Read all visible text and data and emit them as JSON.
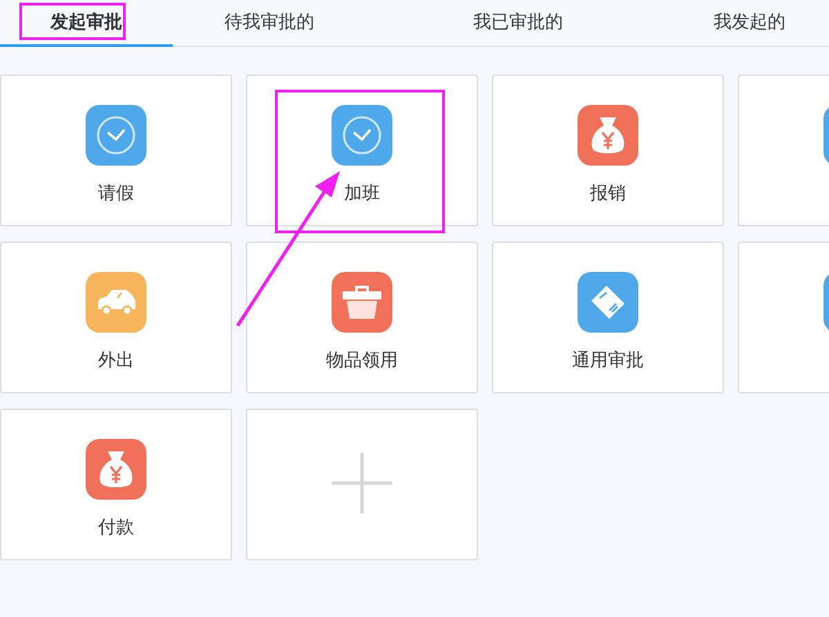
{
  "tabs": [
    {
      "label": "发起审批",
      "selected": true,
      "highlighted": true
    },
    {
      "label": "待我审批的",
      "selected": false,
      "highlighted": false
    },
    {
      "label": "我已审批的",
      "selected": false,
      "highlighted": false
    },
    {
      "label": "我发起的",
      "selected": false,
      "highlighted": false
    }
  ],
  "cards": [
    {
      "kind": "clock",
      "label": "请假",
      "color": "#4ea8ea",
      "highlighted": false
    },
    {
      "kind": "clock",
      "label": "加班",
      "color": "#4ea8ea",
      "highlighted": true
    },
    {
      "kind": "money",
      "label": "报销",
      "color": "#f0705a",
      "highlighted": false
    },
    {
      "kind": "partial",
      "color": "#4ea8ea",
      "highlighted": false
    },
    {
      "kind": "car",
      "label": "外出",
      "color": "#f8b65c",
      "highlighted": false
    },
    {
      "kind": "toolbox",
      "label": "物品领用",
      "color": "#f0705a",
      "highlighted": false
    },
    {
      "kind": "handshake",
      "label": "通用审批",
      "color": "#4ea8ea",
      "highlighted": false
    },
    {
      "kind": "partial",
      "color": "#4ea8ea",
      "highlighted": false
    },
    {
      "kind": "money",
      "label": "付款",
      "color": "#f0705a",
      "highlighted": false
    },
    {
      "kind": "add",
      "highlighted": false
    }
  ]
}
